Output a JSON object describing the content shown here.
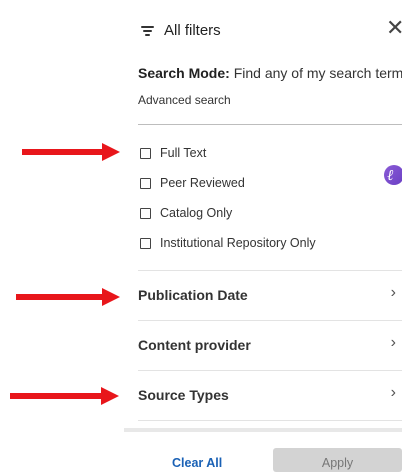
{
  "header": {
    "title": "All filters",
    "filter_icon": "filter-lines-icon",
    "close_glyph": "✕"
  },
  "search_mode": {
    "label": "Search Mode:",
    "value": "Find any of my search terms"
  },
  "advanced_search": "Advanced search",
  "checkboxes": [
    {
      "label": "Full Text",
      "checked": false
    },
    {
      "label": "Peer Reviewed",
      "checked": false
    },
    {
      "label": "Catalog Only",
      "checked": false
    },
    {
      "label": "Institutional Repository Only",
      "checked": false
    }
  ],
  "sections": [
    {
      "label": "Publication Date",
      "chevron": "›"
    },
    {
      "label": "Content provider",
      "chevron": "›"
    },
    {
      "label": "Source Types",
      "chevron": "›"
    }
  ],
  "footer": {
    "clear_label": "Clear All",
    "apply_label": "Apply"
  },
  "colors": {
    "arrow": "#e8161b",
    "link": "#1a61b5",
    "apply_bg": "#d3d3d3",
    "badge": "#7a4fd0"
  },
  "badge_glyph": "ℓ"
}
